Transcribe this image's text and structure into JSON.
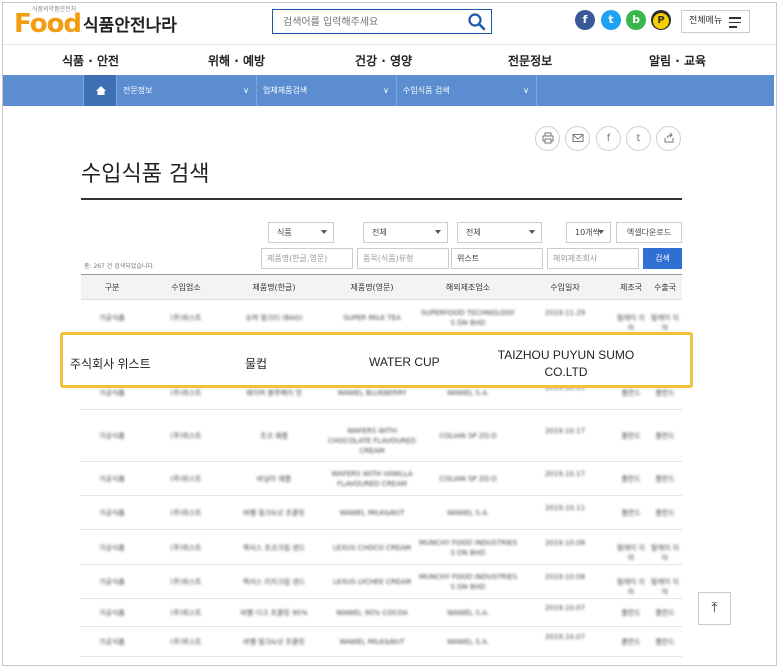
{
  "header": {
    "logo_tag": "식품의약품안전처",
    "logo_food": "Food",
    "logo_kr": "식품안전나라",
    "search_placeholder": "검색어를 입력해주세요",
    "all_menu": "전체메뉴"
  },
  "social": {
    "facebook": "f",
    "twitter": "t",
    "blog": "b",
    "kakao": "P"
  },
  "gnb": [
    "식품 · 안전",
    "위해 · 예방",
    "건강 · 영양",
    "전문정보",
    "알림 · 교육"
  ],
  "subnav": [
    "전문정보",
    "업체제품검색",
    "수입식품 검색"
  ],
  "page": {
    "title": "수입식품 검색"
  },
  "filters": {
    "sel1": "식품",
    "sel2": "전체",
    "sel3": "전체",
    "per_page": "10개씩",
    "excel": "엑셀다운로드",
    "product_kr_placeholder": "제품명(한글,영문)",
    "type_placeholder": "품목(식품)유형",
    "company_value": "위스트",
    "mfr_placeholder": "해외제조회사",
    "search_btn": "검색",
    "count_text": "총: 267 건 검색되었습니다."
  },
  "table": {
    "headers": [
      "구분",
      "수입업소",
      "제품명(한글)",
      "제품명(영문)",
      "해외제조업소",
      "수입일자",
      "제조국",
      "수출국"
    ],
    "rows": [
      [
        "가공식품",
        "(주)위스트",
        "슈퍼 밀크티 (BAG)",
        "SUPER MILK TEA",
        "SUPERFOOD TECHNOLOGY S DN BHD",
        "2019.11.29",
        "말레이 지아",
        "말레이 지아"
      ],
      [
        "가공식품",
        "(주)위스트",
        "웨이퍼 블루베리 맛",
        "WAWEL BLUEBERRY",
        "WAWEL S.A.",
        "2019.10.25",
        "폴란드",
        "폴란드"
      ],
      [
        "가공식품",
        "(주)위스트",
        "초코 웨플",
        "WAFERS WITH CHOCOLATE FLAVOURED CREAM",
        "COLIAN SP ZO.O",
        "2019.10.17",
        "폴란드",
        "폴란드"
      ],
      [
        "가공식품",
        "(주)위스트",
        "바닐라 웨플",
        "WAFERS WITH VANILLA FLAVOURED CREAM",
        "COLIAN SP ZO.O",
        "2019.10.17",
        "폴란드",
        "폴란드"
      ],
      [
        "가공식품",
        "(주)위스트",
        "바벨 밀크&넛 초콜릿",
        "WAWEL MILK&NUT",
        "WAWEL S.A.",
        "2019.10.11",
        "폴란드",
        "폴란드"
      ],
      [
        "가공식품",
        "(주)위스트",
        "렉서스 초코크림 샌드",
        "LEXUS CHOCO CREAM",
        "MUNCHY FOOD INDUSTRIES S DN BHD",
        "2019.10.08",
        "말레이 지아",
        "말레이 지아"
      ],
      [
        "가공식품",
        "(주)위스트",
        "렉서스 리치크림 샌드",
        "LEXUS LYCHEE CREAM",
        "MUNCHY FOOD INDUSTRIES S DN BHD",
        "2019.10.08",
        "말레이 지아",
        "말레이 지아"
      ],
      [
        "가공식품",
        "(주)위스트",
        "바벨 다크 초콜릿 90%",
        "WAWEL 90% COCOA",
        "WAWEL S.A.",
        "2019.10.07",
        "폴란드",
        "폴란드"
      ],
      [
        "가공식품",
        "(주)위스트",
        "바벨 밀크&넛 초콜릿",
        "WAWEL MILK&NUT",
        "WAWEL S.A.",
        "2019.10.07",
        "폴란드",
        "폴란드"
      ]
    ]
  },
  "highlight": {
    "importer": "주식회사 위스트",
    "product_kr": "물컵",
    "product_en": "WATER CUP",
    "manufacturer": "TAIZHOU PUYUN SUMO CO.LTD"
  },
  "top_button": "⤒"
}
